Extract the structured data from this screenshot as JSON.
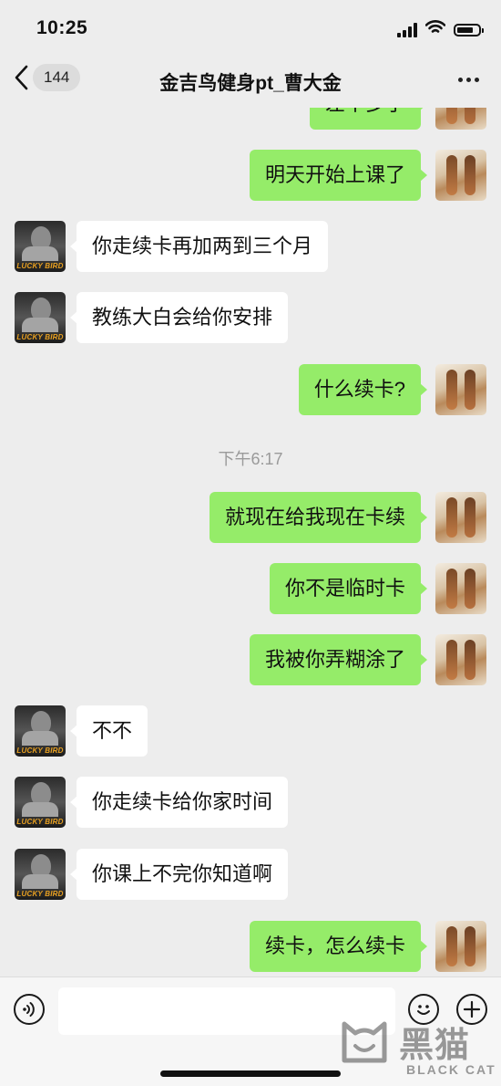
{
  "status_bar": {
    "time": "10:25"
  },
  "nav": {
    "back_count": "144",
    "title": "金吉鸟健身pt_曹大金"
  },
  "messages": [
    {
      "from": "me",
      "text": "差不多了"
    },
    {
      "from": "me",
      "text": "明天开始上课了"
    },
    {
      "from": "them",
      "text": "你走续卡再加两到三个月"
    },
    {
      "from": "them",
      "text": "教练大白会给你安排"
    },
    {
      "from": "me",
      "text": "什么续卡?"
    },
    {
      "from": "me",
      "text": "就现在给我现在卡续"
    },
    {
      "from": "me",
      "text": "你不是临时卡"
    },
    {
      "from": "me",
      "text": "我被你弄糊涂了"
    },
    {
      "from": "them",
      "text": "不不"
    },
    {
      "from": "them",
      "text": "你走续卡给你家时间"
    },
    {
      "from": "them",
      "text": "你课上不完你知道啊"
    },
    {
      "from": "me",
      "text": "续卡，怎么续卡"
    }
  ],
  "timestamp": "下午6:17",
  "avatar_label": "LUCKY BIRD",
  "input": {
    "value": ""
  },
  "watermark": {
    "cn": "黑猫",
    "en": "BLACK CAT"
  },
  "colors": {
    "my_bubble": "#95ec69",
    "their_bubble": "#ffffff",
    "background": "#ededed"
  },
  "icons": [
    "back-chevron-icon",
    "more-dots-icon",
    "voice-icon",
    "emoji-icon",
    "plus-icon",
    "signal-icon",
    "wifi-icon",
    "battery-icon"
  ]
}
